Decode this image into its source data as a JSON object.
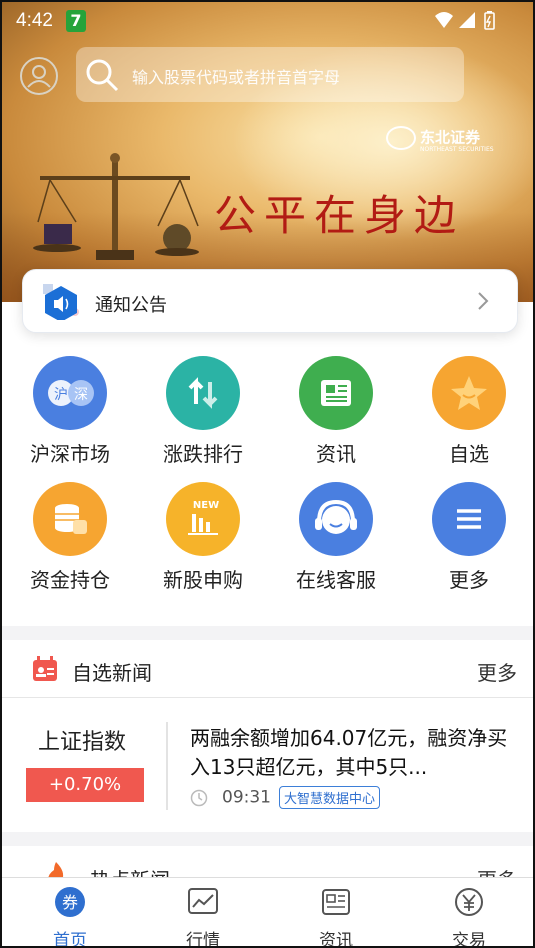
{
  "status_bar": {
    "time": "4:42",
    "notification_badge": "7"
  },
  "search": {
    "placeholder": "输入股票代码或者拼音首字母"
  },
  "banner": {
    "brand": "东北证券",
    "brand_sub": "NORTHEAST SECURITIES",
    "slogan": "公平在身边"
  },
  "notice": {
    "label": "通知公告"
  },
  "shortcuts": [
    {
      "label": "沪深市场",
      "icon": "hushen-icon",
      "color": "#4a7fe0",
      "text1": "沪",
      "text2": "深"
    },
    {
      "label": "涨跌排行",
      "icon": "updown-arrows-icon",
      "color": "#2bb3a5"
    },
    {
      "label": "资讯",
      "icon": "newspaper-icon",
      "color": "#3fae4f"
    },
    {
      "label": "自选",
      "icon": "star-icon",
      "color": "#f6a531"
    },
    {
      "label": "资金持仓",
      "icon": "coins-icon",
      "color": "#f6a531"
    },
    {
      "label": "新股申购",
      "icon": "new-stock-icon",
      "color": "#f6b32a",
      "badge": "NEW"
    },
    {
      "label": "在线客服",
      "icon": "headset-icon",
      "color": "#4a7fe0"
    },
    {
      "label": "更多",
      "icon": "menu-icon",
      "color": "#4a7fe0"
    }
  ],
  "watch_news": {
    "title": "自选新闻",
    "more": "更多"
  },
  "index": {
    "name": "上证指数",
    "change": "+0.70%"
  },
  "news_item": {
    "headline": "两融余额增加64.07亿元，融资净买入13只超亿元，其中5只...",
    "time": "09:31",
    "source": "大智慧数据中心"
  },
  "hot_news": {
    "title": "热点新闻",
    "more": "更多"
  },
  "tabs": [
    {
      "label": "首页",
      "active": true,
      "icon": "home-icon"
    },
    {
      "label": "行情",
      "active": false,
      "icon": "chart-icon"
    },
    {
      "label": "资讯",
      "active": false,
      "icon": "news-icon"
    },
    {
      "label": "交易",
      "active": false,
      "icon": "yuan-icon"
    }
  ],
  "colors": {
    "accent": "#2f6fcf",
    "up": "#f0584f",
    "slogan": "#b21b14"
  }
}
